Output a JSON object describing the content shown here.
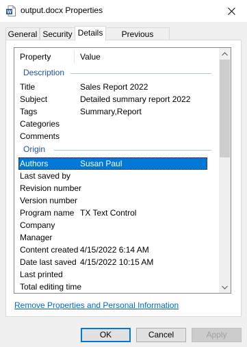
{
  "window": {
    "title": "output.docx Properties",
    "icon": "word-doc-icon",
    "close_glyph": "✕"
  },
  "tabs": [
    {
      "label": "General",
      "active": false
    },
    {
      "label": "Security",
      "active": false
    },
    {
      "label": "Details",
      "active": true
    },
    {
      "label": "Previous Versions",
      "active": false
    }
  ],
  "details": {
    "column_property": "Property",
    "column_value": "Value",
    "groups": {
      "description": "Description",
      "origin": "Origin"
    },
    "rows": [
      {
        "name": "Title",
        "value": "Sales Report 2022"
      },
      {
        "name": "Subject",
        "value": "Detailed summary report 2022"
      },
      {
        "name": "Tags",
        "value": "Summary,Report"
      },
      {
        "name": "Categories",
        "value": ""
      },
      {
        "name": "Comments",
        "value": ""
      },
      {
        "name": "Authors",
        "value": "Susan Paul",
        "selected": true
      },
      {
        "name": "Last saved by",
        "value": ""
      },
      {
        "name": "Revision number",
        "value": ""
      },
      {
        "name": "Version number",
        "value": ""
      },
      {
        "name": "Program name",
        "value": "TX Text Control"
      },
      {
        "name": "Company",
        "value": ""
      },
      {
        "name": "Manager",
        "value": ""
      },
      {
        "name": "Content created",
        "value": "4/15/2022 6:14 AM"
      },
      {
        "name": "Date last saved",
        "value": "4/15/2022 10:15 AM"
      },
      {
        "name": "Last printed",
        "value": ""
      },
      {
        "name": "Total editing time",
        "value": ""
      }
    ]
  },
  "remove_link": "Remove Properties and Personal Information",
  "buttons": {
    "ok": "OK",
    "cancel": "Cancel",
    "apply": "Apply"
  },
  "colors": {
    "selection": "#0078d7",
    "group_text": "#1f4fa0",
    "link": "#0066cc"
  }
}
